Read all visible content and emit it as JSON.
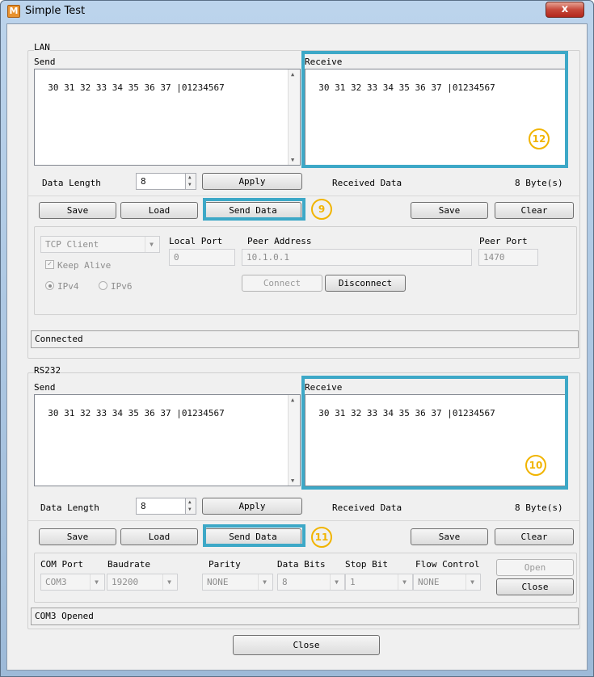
{
  "window": {
    "title": "Simple Test",
    "app_icon_letter": "M",
    "close_glyph": "x"
  },
  "lan": {
    "group_label": "LAN",
    "send_label": "Send",
    "send_text": "30 31 32 33 34 35 36 37 |01234567",
    "receive_label": "Receive",
    "receive_text": "30 31 32 33 34 35 36 37 |01234567",
    "data_length_label": "Data Length",
    "data_length_value": "8",
    "apply_label": "Apply",
    "received_data_label": "Received Data",
    "received_bytes": "8  Byte(s)",
    "save_label": "Save",
    "load_label": "Load",
    "send_data_label": "Send Data",
    "recv_save_label": "Save",
    "clear_label": "Clear",
    "mode_value": "TCP Client",
    "keep_alive_label": "Keep Alive",
    "keep_alive_checked": true,
    "ipv4_label": "IPv4",
    "ipv6_label": "IPv6",
    "local_port_label": "Local Port",
    "local_port_value": "0",
    "peer_address_label": "Peer Address",
    "peer_address_value": "10.1.0.1",
    "peer_port_label": "Peer Port",
    "peer_port_value": "1470",
    "connect_label": "Connect",
    "disconnect_label": "Disconnect",
    "status": "Connected"
  },
  "rs232": {
    "group_label": "RS232",
    "send_label": "Send",
    "send_text": "30 31 32 33 34 35 36 37 |01234567",
    "receive_label": "Receive",
    "receive_text": "30 31 32 33 34 35 36 37 |01234567",
    "data_length_label": "Data Length",
    "data_length_value": "8",
    "apply_label": "Apply",
    "received_data_label": "Received Data",
    "received_bytes": "8  Byte(s)",
    "save_label": "Save",
    "load_label": "Load",
    "send_data_label": "Send Data",
    "recv_save_label": "Save",
    "clear_label": "Clear",
    "com_port_label": "COM Port",
    "com_port_value": "COM3",
    "baudrate_label": "Baudrate",
    "baudrate_value": "19200",
    "parity_label": "Parity",
    "parity_value": "NONE",
    "data_bits_label": "Data Bits",
    "data_bits_value": "8",
    "stop_bit_label": "Stop Bit",
    "stop_bit_value": "1",
    "flow_control_label": "Flow Control",
    "flow_control_value": "NONE",
    "open_label": "Open",
    "close_port_label": "Close",
    "status": "COM3 Opened"
  },
  "callouts": {
    "lan_send_data": "9",
    "lan_receive": "12",
    "rs232_receive": "10",
    "rs232_send_data": "11"
  },
  "footer": {
    "close_label": "Close"
  },
  "colors": {
    "highlight": "#3da8c7",
    "badge": "#f1b400"
  }
}
